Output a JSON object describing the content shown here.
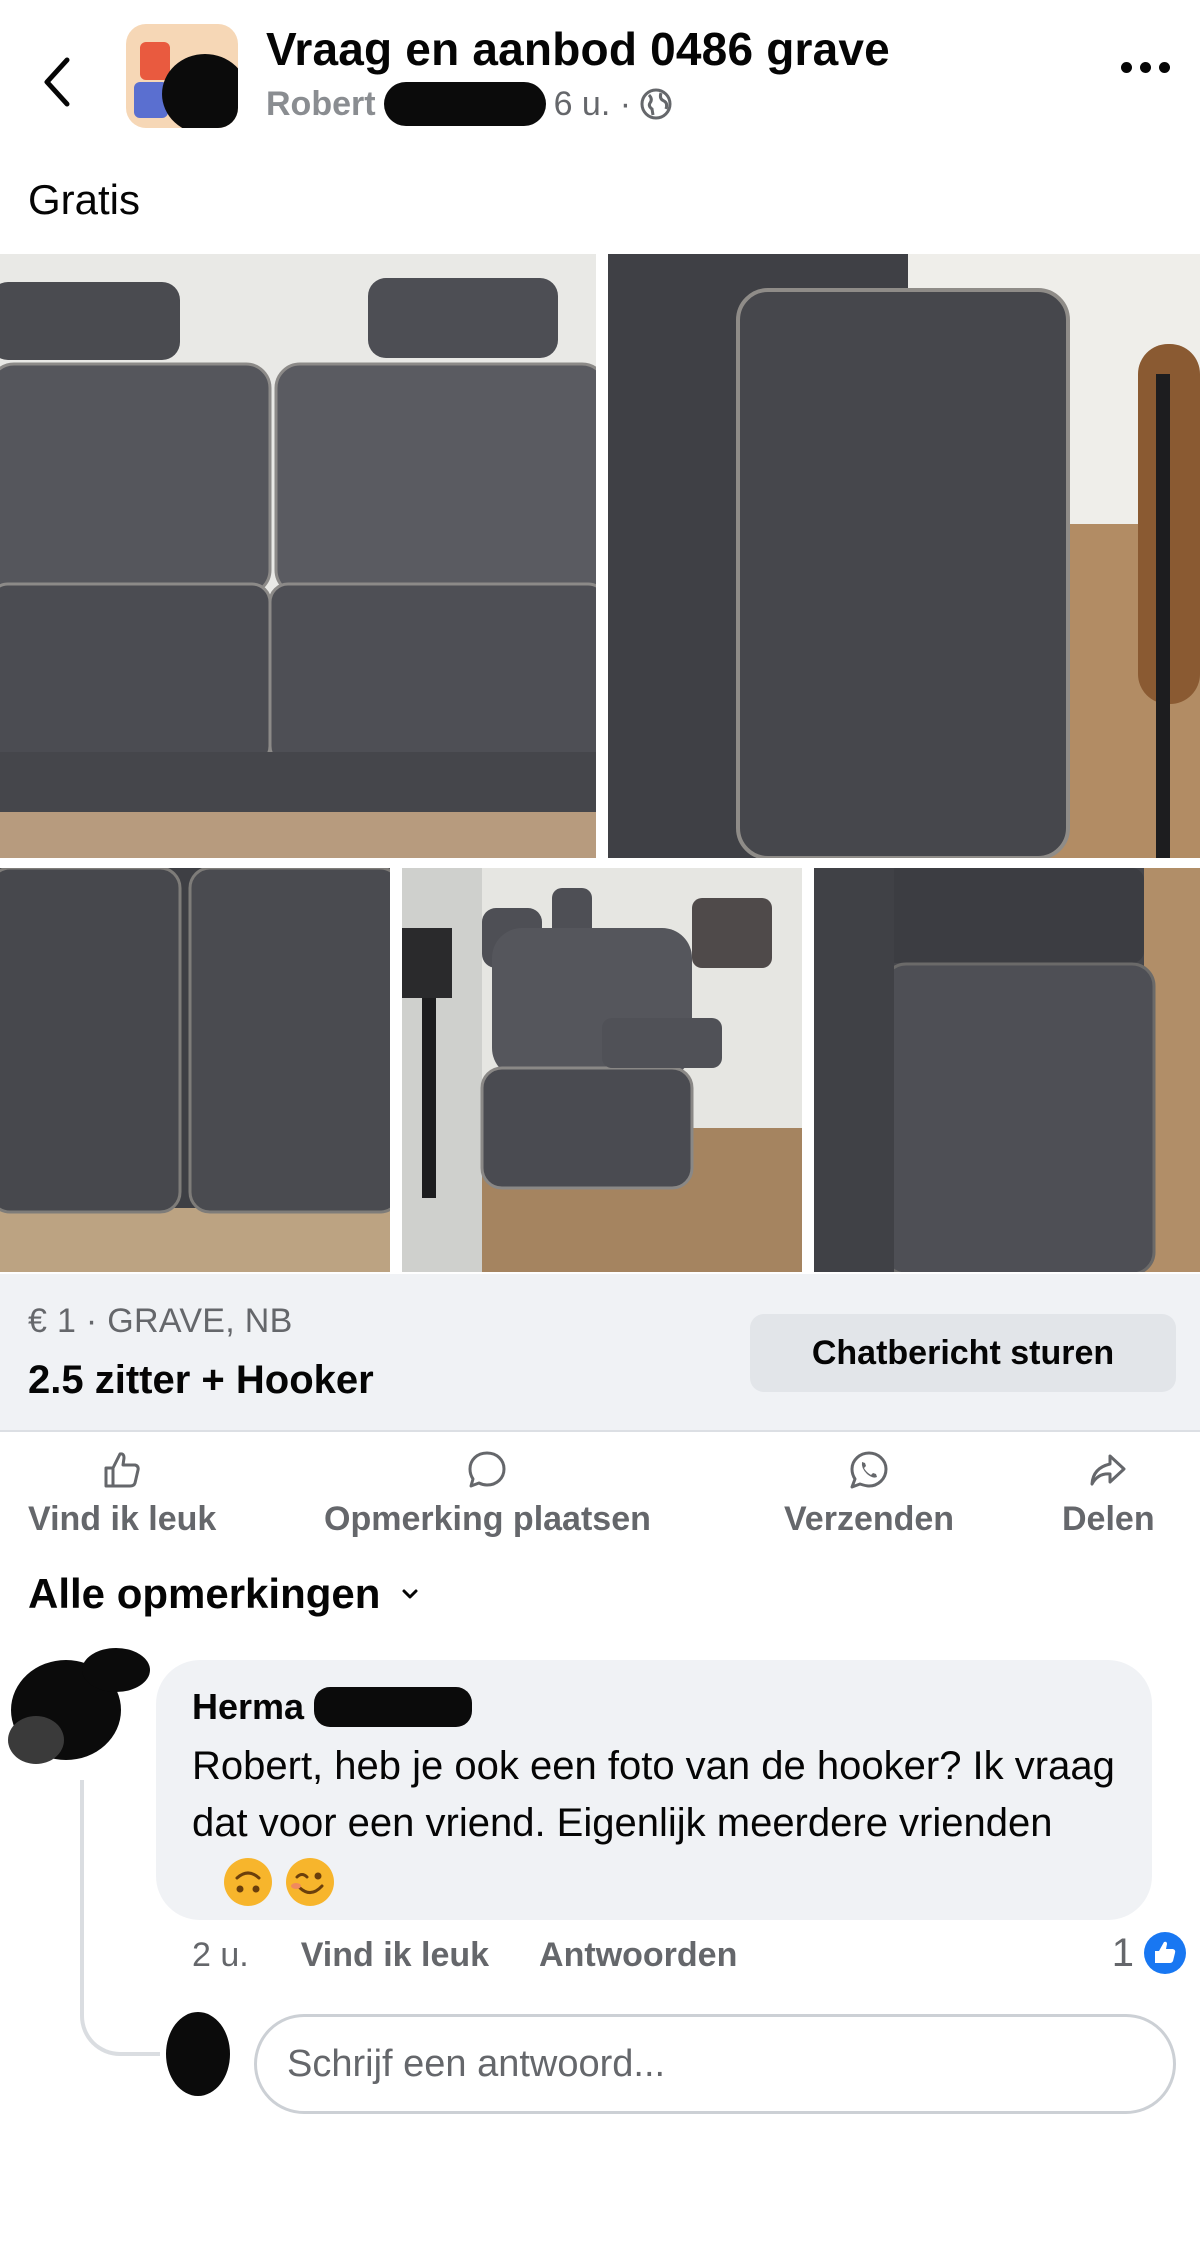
{
  "header": {
    "group_name": "Vraag en aanbod 0486 grave",
    "author": "Robert",
    "time": "6 u. ·",
    "icons": {
      "back": "chevron-left-icon",
      "audience": "globe-icon",
      "more": "more-horizontal-icon"
    }
  },
  "post": {
    "text": "Gratis"
  },
  "listing": {
    "price_location": "€ 1 · GRAVE, NB",
    "title": "2.5 zitter + Hooker",
    "chat_button": "Chatbericht sturen"
  },
  "actions": {
    "like": "Vind ik leuk",
    "comment": "Opmerking plaatsen",
    "send": "Verzenden",
    "share": "Delen"
  },
  "comments": {
    "filter_label": "Alle opmerkingen",
    "items": [
      {
        "author": "Herma",
        "text": "Robert, heb je ook een foto van de hooker? Ik vraag dat voor een vriend. Eigenlijk meerdere vrienden",
        "time": "2 u.",
        "like_label": "Vind ik leuk",
        "reply_label": "Antwoorden",
        "reaction_count": "1"
      }
    ],
    "reply_placeholder": "Schrijf een antwoord..."
  },
  "colors": {
    "secondary_text": "#65676b",
    "listing_bg": "#f0f2f5",
    "like_blue": "#1877f2"
  }
}
